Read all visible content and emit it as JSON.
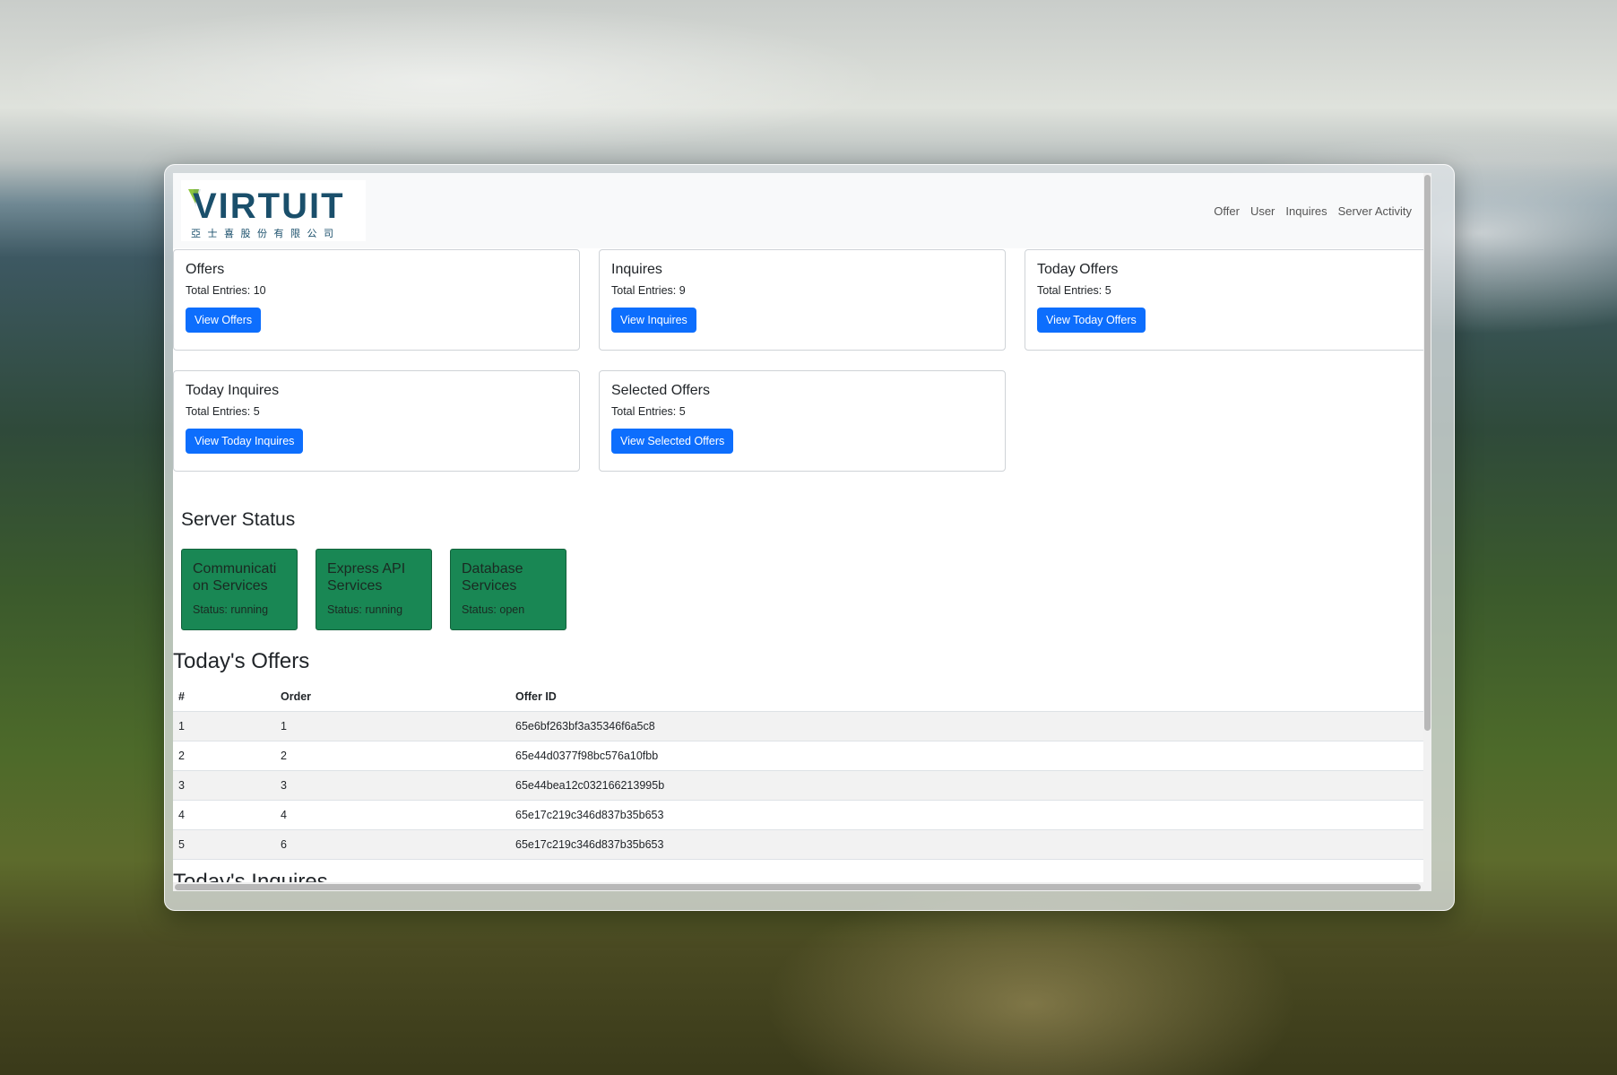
{
  "brand": {
    "name": "VIRTUIT",
    "subtitle": "亞士喜股份有限公司",
    "colors": {
      "primary": "#1a4f6b",
      "accent": "#8dc63f"
    }
  },
  "nav": {
    "items": [
      {
        "label": "Offer"
      },
      {
        "label": "User"
      },
      {
        "label": "Inquires"
      },
      {
        "label": "Server Activity"
      }
    ]
  },
  "cards": [
    {
      "title": "Offers",
      "text": "Total Entries: 10",
      "button": "View Offers"
    },
    {
      "title": "Inquires",
      "text": "Total Entries: 9",
      "button": "View Inquires"
    },
    {
      "title": "Today Offers",
      "text": "Total Entries: 5",
      "button": "View Today Offers"
    },
    {
      "title": "Today Inquires",
      "text": "Total Entries: 5",
      "button": "View Today Inquires"
    },
    {
      "title": "Selected Offers",
      "text": "Total Entries: 5",
      "button": "View Selected Offers"
    }
  ],
  "server_status": {
    "title": "Server Status",
    "services": [
      {
        "name": "Communicati on Services",
        "status": "Status: running"
      },
      {
        "name": "Express API Services",
        "status": "Status: running"
      },
      {
        "name": "Database Services",
        "status": "Status: open"
      }
    ]
  },
  "todays_offers": {
    "title": "Today's Offers",
    "columns": [
      "#",
      "Order",
      "Offer ID"
    ],
    "rows": [
      [
        "1",
        "1",
        "65e6bf263bf3a35346f6a5c8"
      ],
      [
        "2",
        "2",
        "65e44d0377f98bc576a10fbb"
      ],
      [
        "3",
        "3",
        "65e44bea12c032166213995b"
      ],
      [
        "4",
        "4",
        "65e17c219c346d837b35b653"
      ],
      [
        "5",
        "6",
        "65e17c219c346d837b35b653"
      ]
    ]
  },
  "todays_inquires": {
    "title": "Today's Inquires"
  }
}
